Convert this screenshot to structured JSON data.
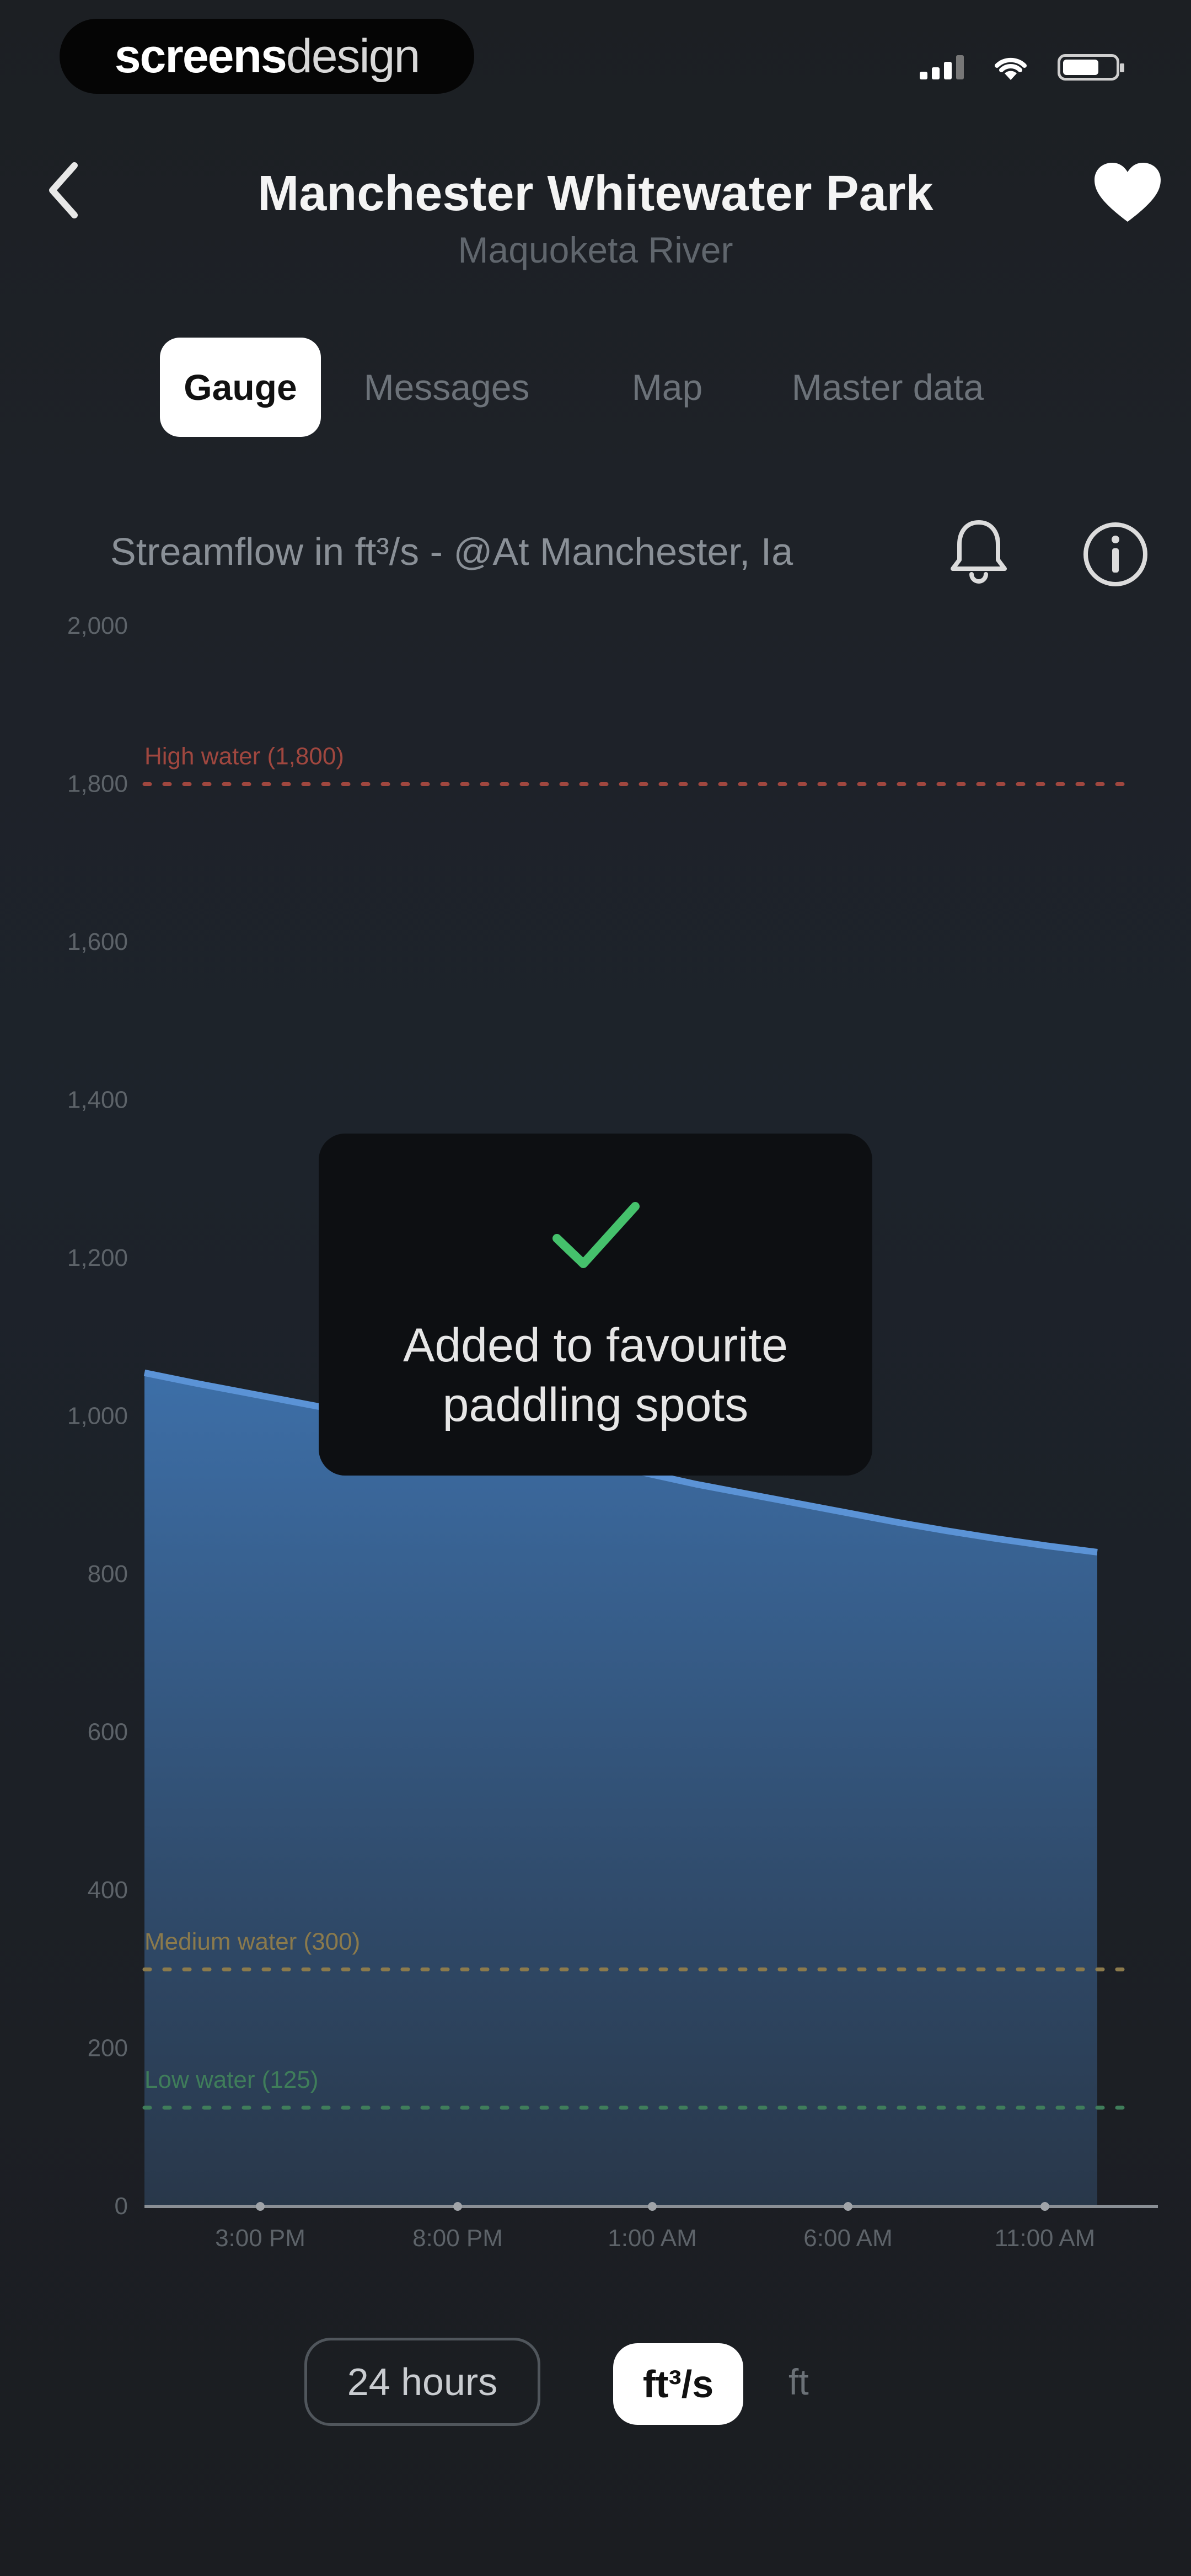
{
  "status_bar": {
    "brand_bold": "screens",
    "brand_light": "design"
  },
  "header": {
    "title": "Manchester Whitewater Park",
    "subtitle": "Maquoketa River"
  },
  "tabs": [
    {
      "label": "Gauge",
      "active": true
    },
    {
      "label": "Messages",
      "active": false
    },
    {
      "label": "Map",
      "active": false
    },
    {
      "label": "Master data",
      "active": false
    }
  ],
  "chart_header": {
    "title": "Streamflow in ft³/s - @At Manchester, Ia"
  },
  "colors": {
    "area_top": "#3d6fa8",
    "line": "#5b93d6",
    "high_water": "#a0473f",
    "medium_water": "#8b7a4c",
    "low_water": "#3f7d5a",
    "toast_check": "#45c16c"
  },
  "chart_data": {
    "type": "area",
    "x": [
      "3:00 PM",
      "8:00 PM",
      "1:00 AM",
      "6:00 AM",
      "11:00 AM"
    ],
    "y_ticks": [
      "0",
      "200",
      "400",
      "600",
      "800",
      "1,000",
      "1,200",
      "1,400",
      "1,600",
      "1,800",
      "2,000"
    ],
    "ylim": [
      0,
      2000
    ],
    "series": [
      {
        "values": [
          1055,
          1042,
          1030,
          1018,
          1006,
          995,
          982,
          970,
          957,
          943,
          928,
          914,
          902,
          890,
          878,
          866,
          855,
          845,
          836,
          828
        ]
      }
    ],
    "thresholds": [
      {
        "label": "High water (1,800)",
        "value": 1800,
        "color_key": "high_water"
      },
      {
        "label": "Medium water (300)",
        "value": 300,
        "color_key": "medium_water"
      },
      {
        "label": "Low water (125)",
        "value": 125,
        "color_key": "low_water"
      }
    ],
    "grid": false
  },
  "toast": {
    "message": "Added to favourite paddling spots",
    "icon": "checkmark-icon"
  },
  "controls": {
    "range_label": "24 hours",
    "unit_selected": "ft³/s",
    "unit_other": "ft"
  }
}
